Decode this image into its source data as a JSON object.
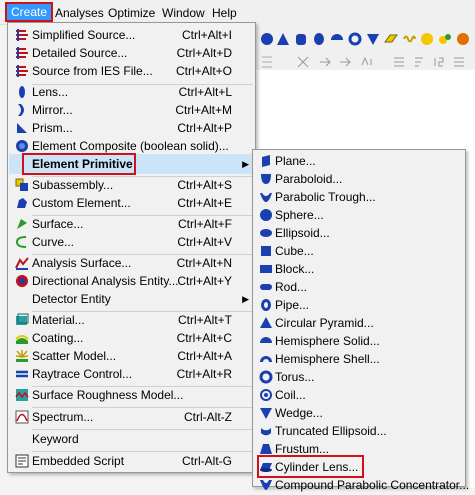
{
  "menubar": {
    "items": [
      "Create",
      "Analyses",
      "Optimize",
      "Window",
      "Help"
    ]
  },
  "create_menu": {
    "items": [
      {
        "label": "Simplified Source...",
        "shortcut": "Ctrl+Alt+I",
        "icon": "simplified-source-icon"
      },
      {
        "label": "Detailed Source...",
        "shortcut": "Ctrl+Alt+D",
        "icon": "detailed-source-icon"
      },
      {
        "label": "Source from IES File...",
        "shortcut": "Ctrl+Alt+O",
        "icon": "ies-source-icon"
      },
      {
        "label": "Lens...",
        "shortcut": "Ctrl+Alt+L",
        "icon": "lens-icon"
      },
      {
        "label": "Mirror...",
        "shortcut": "Ctrl+Alt+M",
        "icon": "mirror-icon"
      },
      {
        "label": "Prism...",
        "shortcut": "Ctrl+Alt+P",
        "icon": "prism-icon"
      },
      {
        "label": "Element Composite (boolean solid)...",
        "shortcut": "",
        "icon": "element-composite-icon"
      },
      {
        "label": "Element Primitive",
        "shortcut": "",
        "icon": ""
      },
      {
        "label": "Subassembly...",
        "shortcut": "Ctrl+Alt+S",
        "icon": "subassembly-icon"
      },
      {
        "label": "Custom Element...",
        "shortcut": "Ctrl+Alt+E",
        "icon": "custom-element-icon"
      },
      {
        "label": "Surface...",
        "shortcut": "Ctrl+Alt+F",
        "icon": "surface-icon"
      },
      {
        "label": "Curve...",
        "shortcut": "Ctrl+Alt+V",
        "icon": "curve-icon"
      },
      {
        "label": "Analysis Surface...",
        "shortcut": "Ctrl+Alt+N",
        "icon": "analysis-surface-icon"
      },
      {
        "label": "Directional Analysis Entity...",
        "shortcut": "Ctrl+Alt+Y",
        "icon": "directional-analysis-icon"
      },
      {
        "label": "Detector Entity",
        "shortcut": "",
        "icon": ""
      },
      {
        "label": "Material...",
        "shortcut": "Ctrl+Alt+T",
        "icon": "material-icon"
      },
      {
        "label": "Coating...",
        "shortcut": "Ctrl+Alt+C",
        "icon": "coating-icon"
      },
      {
        "label": "Scatter Model...",
        "shortcut": "Ctrl+Alt+A",
        "icon": "scatter-model-icon"
      },
      {
        "label": "Raytrace Control...",
        "shortcut": "Ctrl+Alt+R",
        "icon": "raytrace-control-icon"
      },
      {
        "label": "Surface Roughness Model...",
        "shortcut": "",
        "icon": "surface-roughness-icon"
      },
      {
        "label": "Spectrum...",
        "shortcut": "Ctrl-Alt-Z",
        "icon": "spectrum-icon"
      },
      {
        "label": "Keyword",
        "shortcut": "",
        "icon": ""
      },
      {
        "label": "Embedded Script",
        "shortcut": "Ctrl-Alt-G",
        "icon": "embedded-script-icon"
      }
    ]
  },
  "primitive_submenu": {
    "items": [
      {
        "label": "Plane...",
        "icon": "plane-icon"
      },
      {
        "label": "Paraboloid...",
        "icon": "paraboloid-icon"
      },
      {
        "label": "Parabolic Trough...",
        "icon": "parabolic-trough-icon"
      },
      {
        "label": "Sphere...",
        "icon": "sphere-icon"
      },
      {
        "label": "Ellipsoid...",
        "icon": "ellipsoid-icon"
      },
      {
        "label": "Cube...",
        "icon": "cube-icon"
      },
      {
        "label": "Block...",
        "icon": "block-icon"
      },
      {
        "label": "Rod...",
        "icon": "rod-icon"
      },
      {
        "label": "Pipe...",
        "icon": "pipe-icon"
      },
      {
        "label": "Circular Pyramid...",
        "icon": "circular-pyramid-icon"
      },
      {
        "label": "Hemisphere Solid...",
        "icon": "hemisphere-solid-icon"
      },
      {
        "label": "Hemisphere Shell...",
        "icon": "hemisphere-shell-icon"
      },
      {
        "label": "Torus...",
        "icon": "torus-icon"
      },
      {
        "label": "Coil...",
        "icon": "coil-icon"
      },
      {
        "label": "Wedge...",
        "icon": "wedge-icon"
      },
      {
        "label": "Truncated Ellipsoid...",
        "icon": "truncated-ellipsoid-icon"
      },
      {
        "label": "Frustum...",
        "icon": "frustum-icon"
      },
      {
        "label": "Cylinder Lens...",
        "icon": "cylinder-lens-icon"
      },
      {
        "label": "Compound Parabolic Concentrator...",
        "icon": "cpc-icon"
      }
    ]
  },
  "colors": {
    "menu_highlight": "#3399ff",
    "selection": "#cce4f7",
    "annotation_box": "#d0101a",
    "icon_blue": "#1a3fb0"
  }
}
